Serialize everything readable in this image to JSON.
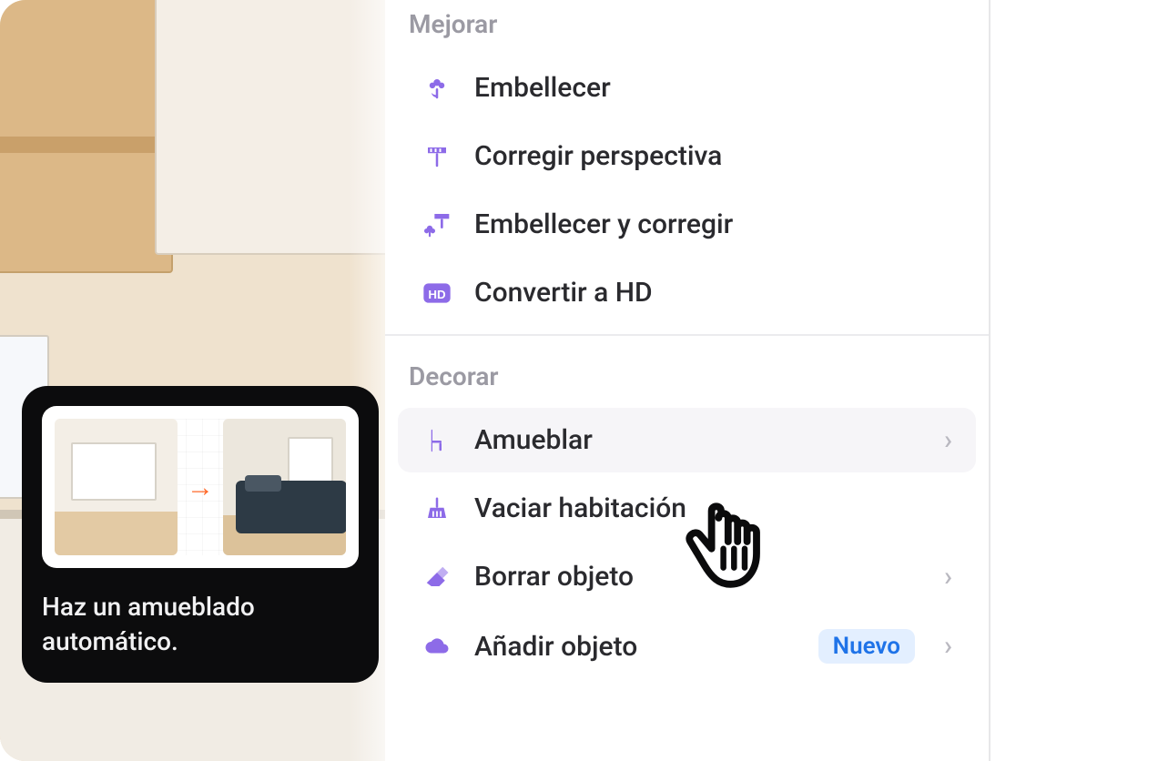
{
  "sections": {
    "improve": {
      "heading": "Mejorar",
      "items": [
        {
          "label": "Embellecer",
          "icon": "flower-icon"
        },
        {
          "label": "Corregir perspectiva",
          "icon": "ruler-icon"
        },
        {
          "label": "Embellecer y corregir",
          "icon": "flower-ruler-icon"
        },
        {
          "label": "Convertir a HD",
          "icon": "hd-icon"
        }
      ]
    },
    "decorate": {
      "heading": "Decorar",
      "items": [
        {
          "label": "Amueblar",
          "icon": "chair-icon",
          "chevron": true,
          "highlighted": true
        },
        {
          "label": "Vaciar habitación",
          "icon": "broom-icon"
        },
        {
          "label": "Borrar objeto",
          "icon": "eraser-icon",
          "chevron": true
        },
        {
          "label": "Añadir objeto",
          "icon": "cloud-icon",
          "chevron": true,
          "badge": "Nuevo"
        }
      ]
    }
  },
  "tooltip": {
    "text": "Haz un amueblado automático."
  },
  "chevron_glyph": "›",
  "arrow_glyph": "→"
}
